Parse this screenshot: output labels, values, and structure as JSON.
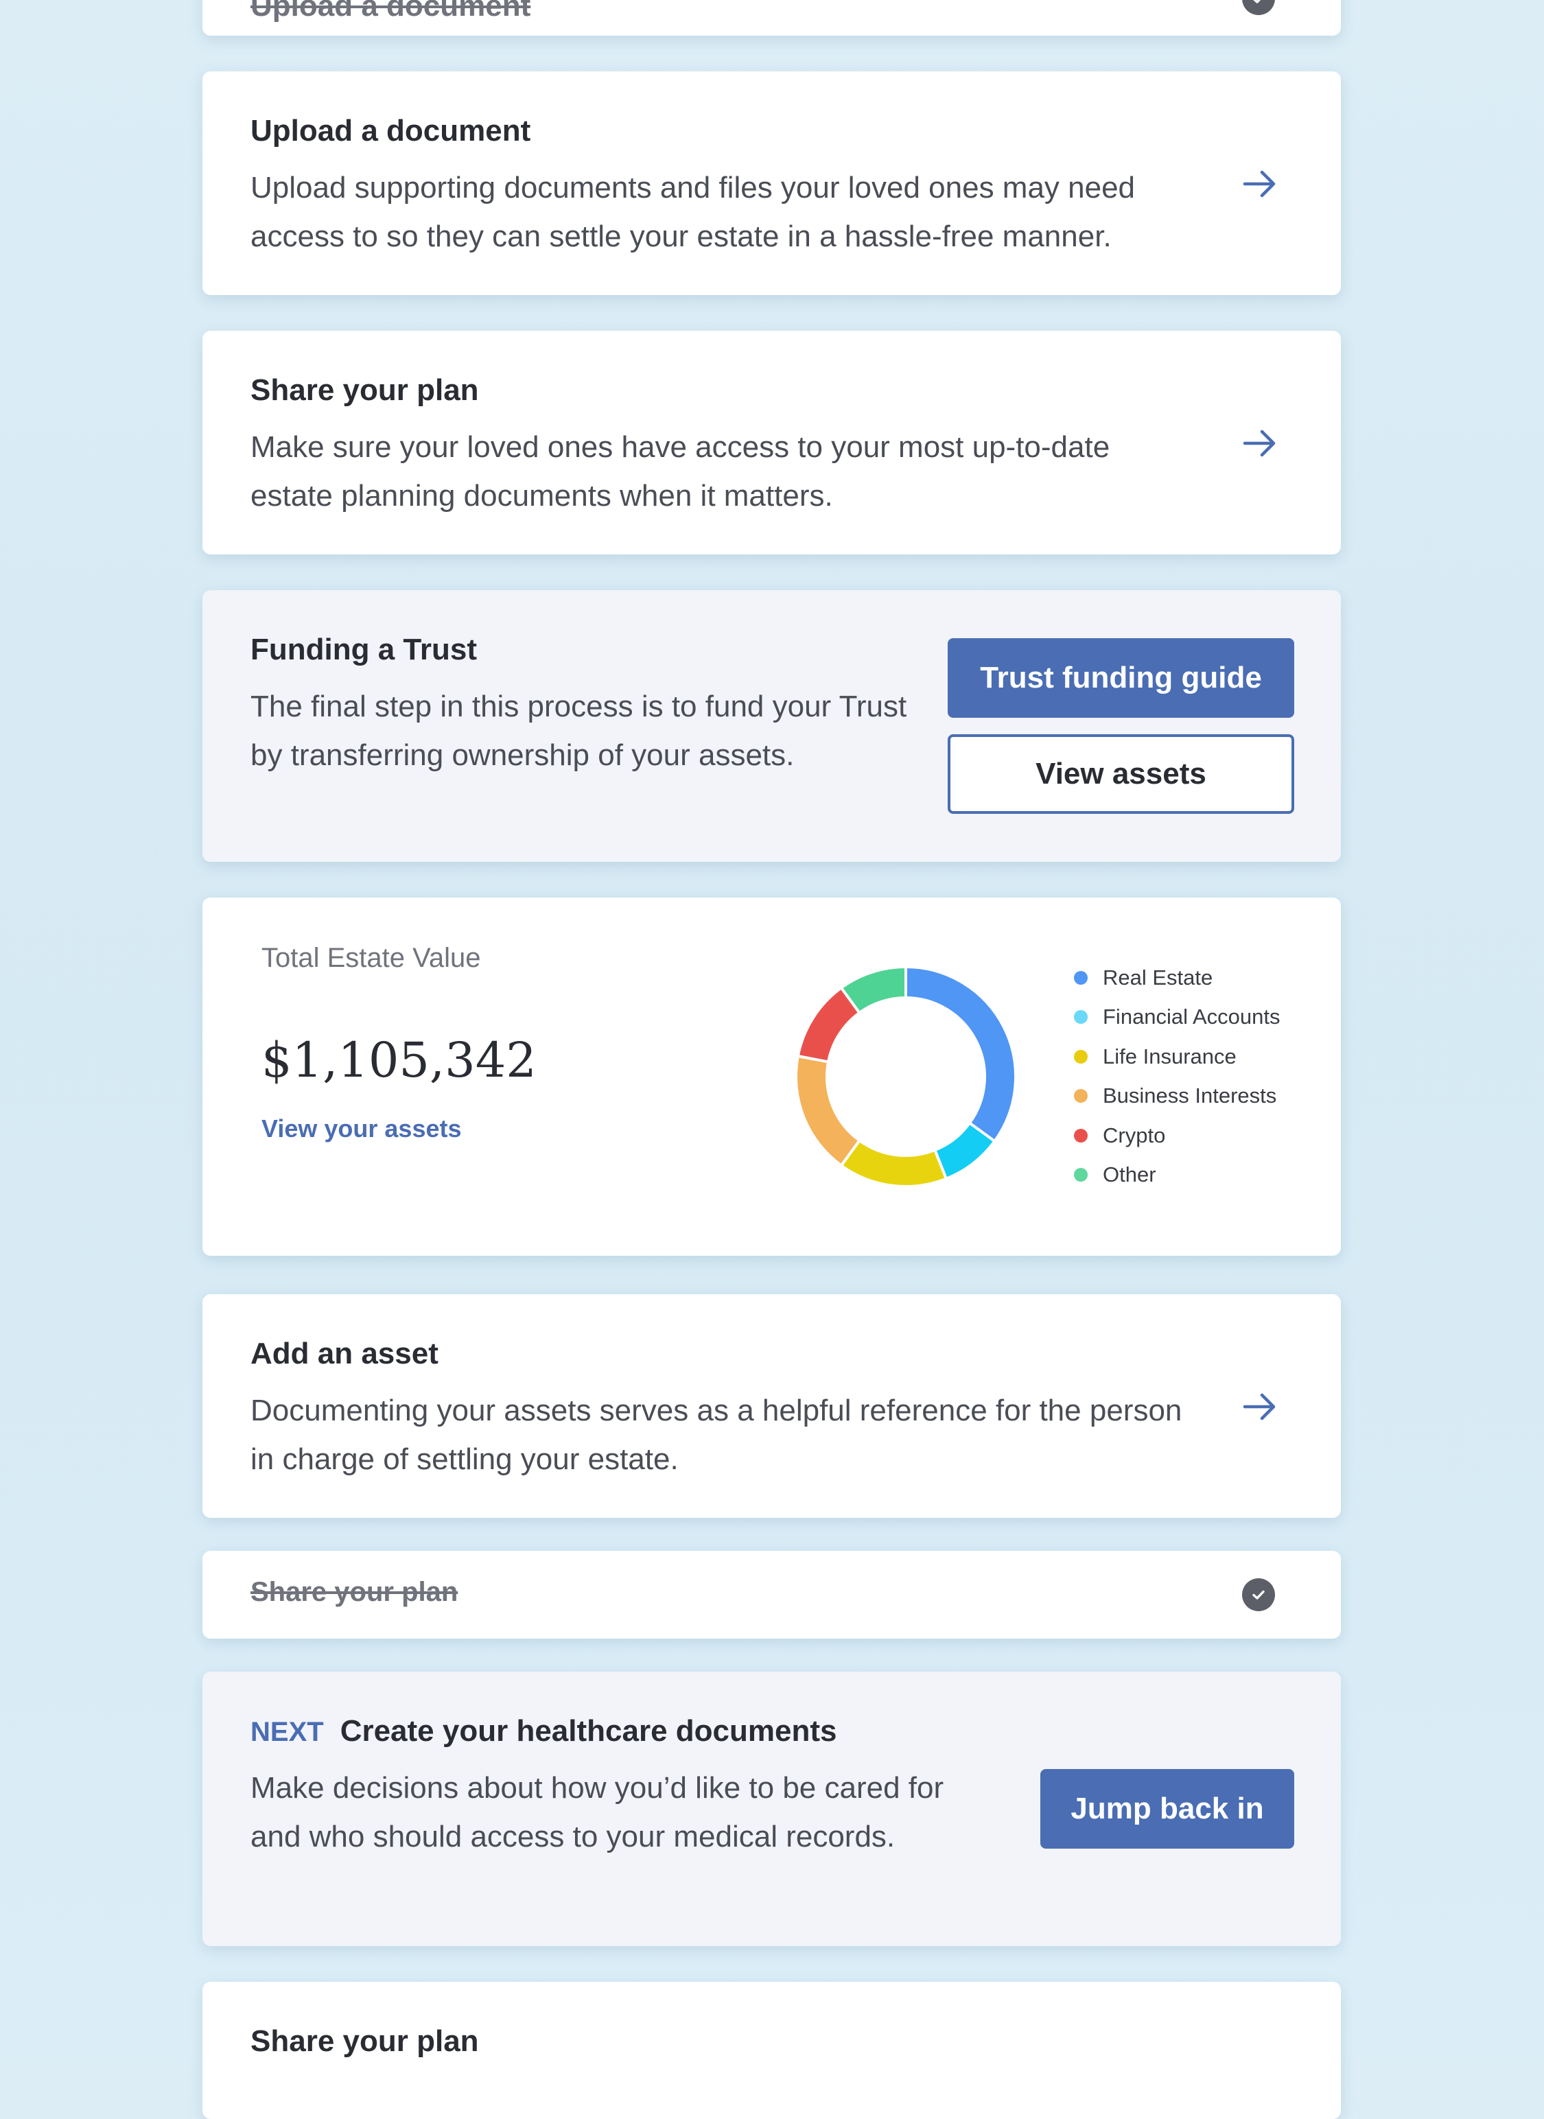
{
  "cards": {
    "upload_done": {
      "title": "Upload a document"
    },
    "upload": {
      "title": "Upload a document",
      "description": "Upload supporting documents and files your loved ones may need access to so they can settle your estate in a hassle-free manner."
    },
    "share_plan": {
      "title": "Share your plan",
      "description": "Make sure your loved ones have access to your most up-to-date estate planning documents when it matters."
    },
    "funding_trust": {
      "title": "Funding a Trust",
      "description": "The final step in this process is to fund your Trust by transferring ownership of your assets.",
      "primary_button": "Trust funding guide",
      "secondary_button": "View assets"
    },
    "estate": {
      "label": "Total Estate Value",
      "value": "$1,105,342",
      "link": "View your assets"
    },
    "add_asset": {
      "title": "Add an asset",
      "description": "Documenting your assets serves as a helpful reference for the person in charge of settling your estate."
    },
    "share_plan_done": {
      "title": "Share your plan"
    },
    "healthcare": {
      "tag": "NEXT",
      "title": "Create your healthcare documents",
      "description": "Make decisions about how you’d like to be cared for and who should access to your medical records.",
      "button": "Jump back in"
    },
    "share_plan_bottom": {
      "title": "Share your plan"
    }
  },
  "icons": {
    "arrow": "arrow-right-icon",
    "check": "check-circle-icon"
  },
  "colors": {
    "accent": "#4a6db3",
    "check": "#5d5f68"
  },
  "chart_data": {
    "type": "pie",
    "donut": true,
    "title": "",
    "categories": [
      "Real Estate",
      "Financial Accounts",
      "Life Insurance",
      "Business Interests",
      "Crypto",
      "Other"
    ],
    "values": [
      35,
      9,
      16,
      18,
      12,
      10
    ],
    "colors": [
      "#4f96f5",
      "#13cdf4",
      "#e8d40e",
      "#f4b25a",
      "#ea504b",
      "#4fd394"
    ],
    "legend_colors": [
      "#4f96f5",
      "#6ad8f7",
      "#e8cc10",
      "#f4b25a",
      "#ea504b",
      "#5fd79d"
    ],
    "legend_position": "right"
  }
}
